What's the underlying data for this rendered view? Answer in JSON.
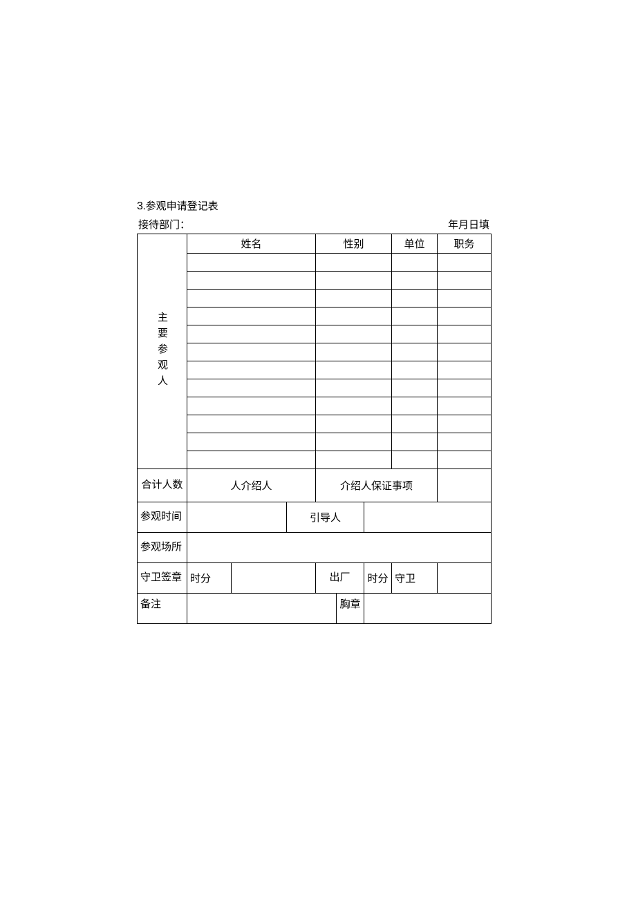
{
  "title_num": "3",
  "title_sep": ".",
  "title_text": "参观申请登记表",
  "header_left": "接待部门：",
  "header_right": "年月日填",
  "vlabel": "主要参观人",
  "col": {
    "name": "姓名",
    "gender": "性别",
    "unit": "单位",
    "position": "职务"
  },
  "rows": {
    "total_people": "合计人数",
    "introducer_text": "人介绍人",
    "guarantee": "介绍人保证事项",
    "visit_time": "参观时间",
    "guide": "引导人",
    "visit_place": "参观场所",
    "guard_sign": "守卫签章",
    "time_hm": "时分",
    "exit": "出厂",
    "exit_hm": "时分",
    "guard": "守卫",
    "remark": "备注",
    "badge": "胸章"
  }
}
